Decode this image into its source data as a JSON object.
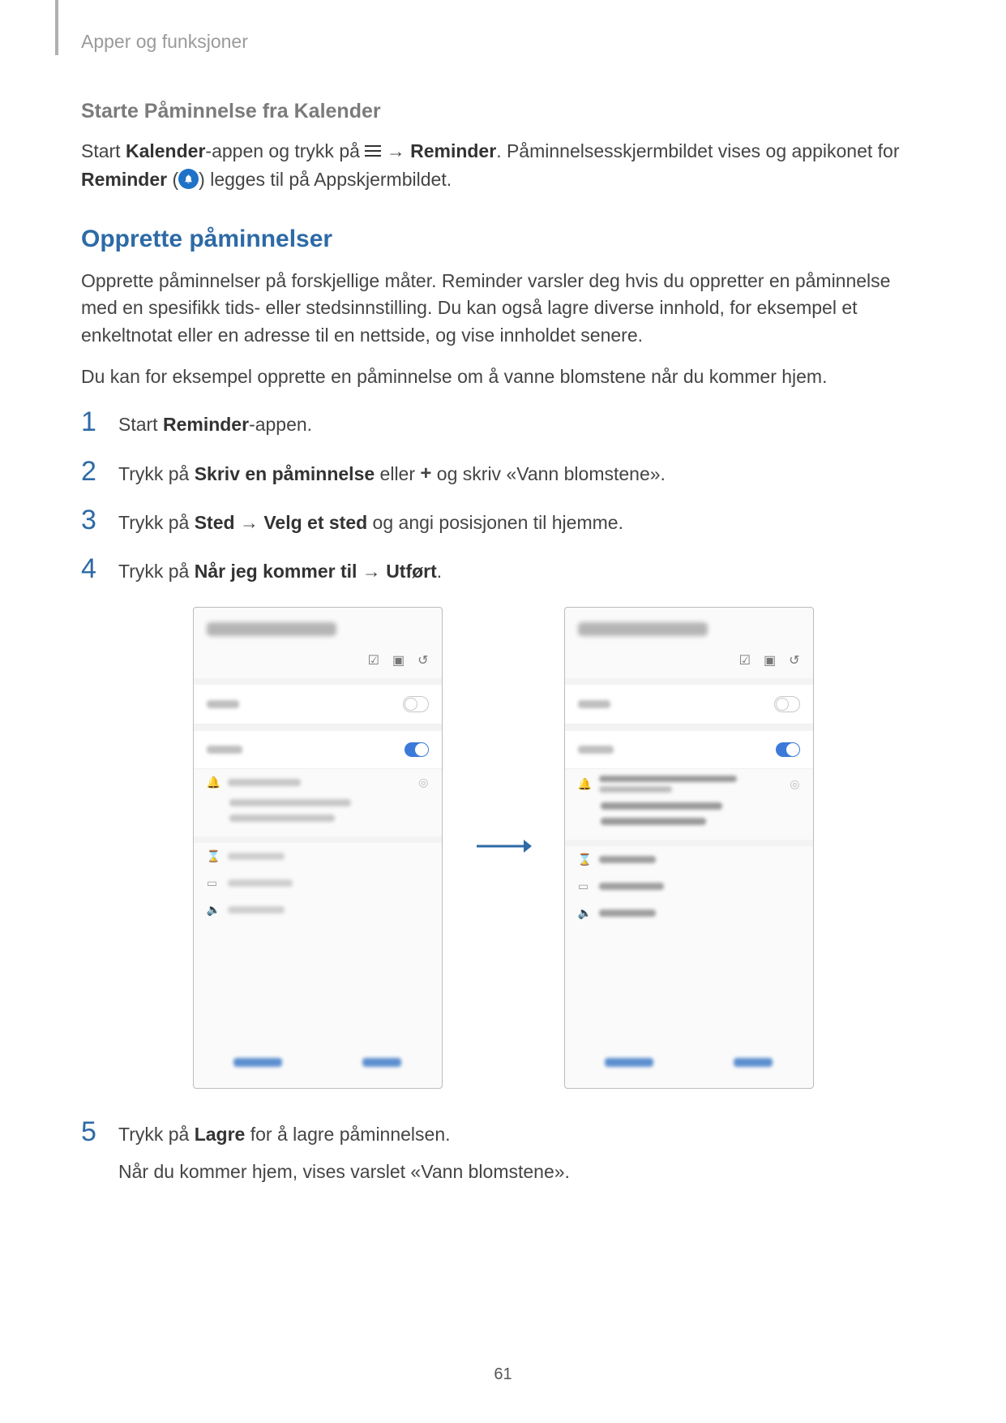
{
  "breadcrumb": "Apper og funksjoner",
  "sub_heading": "Starte Påminnelse fra Kalender",
  "intro": {
    "p1a": "Start ",
    "p1b": "Kalender",
    "p1c": "-appen og trykk på ",
    "p1d": " → ",
    "p1e": "Reminder",
    "p1f": ". Påminnelsesskjermbildet vises og appikonet for ",
    "p1g": "Reminder",
    "p1h": " (",
    "p1i": ") legges til på Appskjermbildet."
  },
  "section_heading": "Opprette påminnelser",
  "para2": "Opprette påminnelser på forskjellige måter. Reminder varsler deg hvis du oppretter en påminnelse med en spesifikk tids- eller stedsinnstilling. Du kan også lagre diverse innhold, for eksempel et enkeltnotat eller en adresse til en nettside, og vise innholdet senere.",
  "para3": "Du kan for eksempel opprette en påminnelse om å vanne blomstene når du kommer hjem.",
  "steps": {
    "s1": {
      "num": "1",
      "a": "Start ",
      "b": "Reminder",
      "c": "-appen."
    },
    "s2": {
      "num": "2",
      "a": "Trykk på ",
      "b": "Skriv en påminnelse",
      "c": " eller ",
      "d": " og skriv «Vann blomstene»."
    },
    "s3": {
      "num": "3",
      "a": "Trykk på ",
      "b": "Sted",
      "c": " → ",
      "d": "Velg et sted",
      "e": " og angi posisjonen til hjemme."
    },
    "s4": {
      "num": "4",
      "a": "Trykk på ",
      "b": "Når jeg kommer til",
      "c": " → ",
      "d": "Utført",
      "e": "."
    },
    "s5": {
      "num": "5",
      "a": "Trykk på ",
      "b": "Lagre",
      "c": " for å lagre påminnelsen.",
      "line2": "Når du kommer hjem, vises varslet «Vann blomstene»."
    }
  },
  "page_number": "61"
}
